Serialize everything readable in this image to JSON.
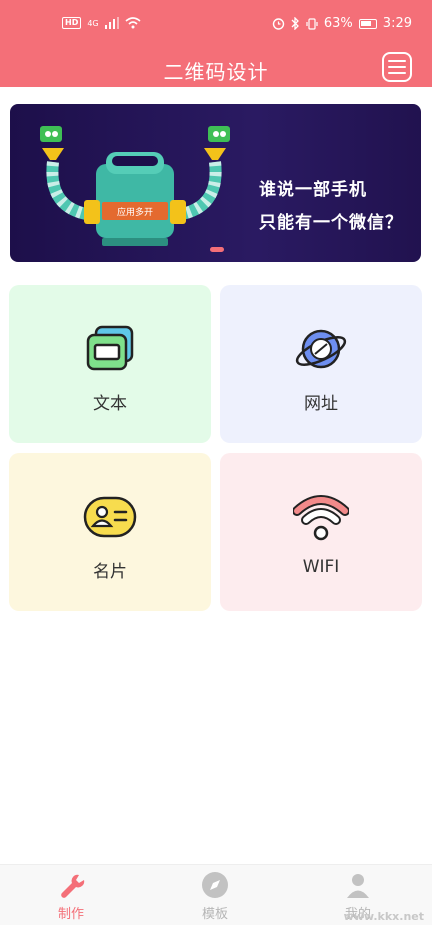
{
  "status_bar": {
    "left_badges": [
      "HD",
      "4G"
    ],
    "battery": "63%",
    "time": "3:29"
  },
  "header": {
    "title": "二维码设计"
  },
  "banner": {
    "robot_sign": "应用多开",
    "line1": "谁说一部手机",
    "line2": "只能有一个微信？"
  },
  "categories": [
    {
      "label": "文本",
      "icon": "text-card-icon"
    },
    {
      "label": "网址",
      "icon": "planet-icon"
    },
    {
      "label": "名片",
      "icon": "contact-card-icon"
    },
    {
      "label": "WIFI",
      "icon": "wifi-icon"
    }
  ],
  "tabbar": {
    "tabs": [
      {
        "label": "制作",
        "icon": "wrench-icon",
        "active": true
      },
      {
        "label": "模板",
        "icon": "compass-icon",
        "active": false
      },
      {
        "label": "我的",
        "icon": "profile-icon",
        "active": false
      }
    ]
  },
  "watermark": "www.kkx.net",
  "colors": {
    "accent": "#f46f78",
    "banner_bg": "#22134f"
  }
}
